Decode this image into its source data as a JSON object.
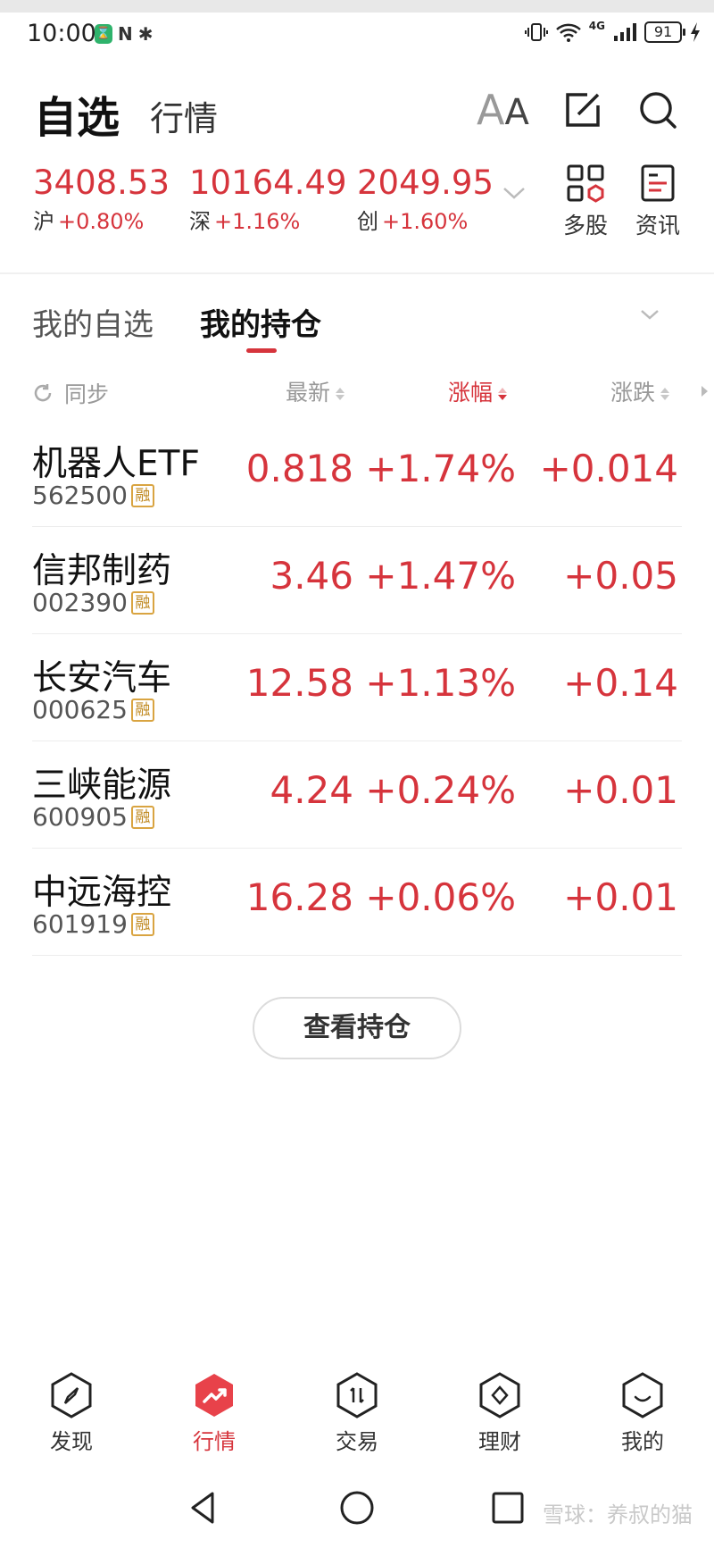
{
  "status_bar": {
    "time": "10:00",
    "nfc_glyph": "N",
    "bluetooth_glyph": "✱",
    "network": "4G",
    "battery": "91"
  },
  "header": {
    "title": "自选",
    "subtitle": "行情",
    "font_size_icon_big": "A",
    "font_size_icon_small": "A"
  },
  "indices": [
    {
      "value": "3408.53",
      "name": "沪",
      "change": "+0.80%"
    },
    {
      "value": "10164.49",
      "name": "深",
      "change": "+1.16%"
    },
    {
      "value": "2049.95",
      "name": "创",
      "change": "+1.60%"
    }
  ],
  "tools": {
    "multi": "多股",
    "news": "资讯"
  },
  "tabs": {
    "watchlist": "我的自选",
    "holdings": "我的持仓"
  },
  "columns": {
    "sync": "同步",
    "latest": "最新",
    "change_pct": "涨幅",
    "change": "涨跌"
  },
  "badge_label": "融",
  "stocks": [
    {
      "name": "机器人ETF",
      "code": "562500",
      "latest": "0.818",
      "change_pct": "+1.74%",
      "change": "+0.014"
    },
    {
      "name": "信邦制药",
      "code": "002390",
      "latest": "3.46",
      "change_pct": "+1.47%",
      "change": "+0.05"
    },
    {
      "name": "长安汽车",
      "code": "000625",
      "latest": "12.58",
      "change_pct": "+1.13%",
      "change": "+0.14"
    },
    {
      "name": "三峡能源",
      "code": "600905",
      "latest": "4.24",
      "change_pct": "+0.24%",
      "change": "+0.01"
    },
    {
      "name": "中远海控",
      "code": "601919",
      "latest": "16.28",
      "change_pct": "+0.06%",
      "change": "+0.01"
    }
  ],
  "view_holdings_button": "查看持仓",
  "bottom_nav": [
    {
      "label": "发现",
      "icon": "compass-icon"
    },
    {
      "label": "行情",
      "icon": "trend-icon"
    },
    {
      "label": "交易",
      "icon": "trade-icon"
    },
    {
      "label": "理财",
      "icon": "wealth-icon"
    },
    {
      "label": "我的",
      "icon": "profile-icon"
    }
  ],
  "watermark": "雪球：养叔的猫",
  "colors": {
    "up_red": "#d6343c",
    "badge_gold": "#d9a441",
    "text_dark": "#111111",
    "text_muted": "#999999"
  }
}
